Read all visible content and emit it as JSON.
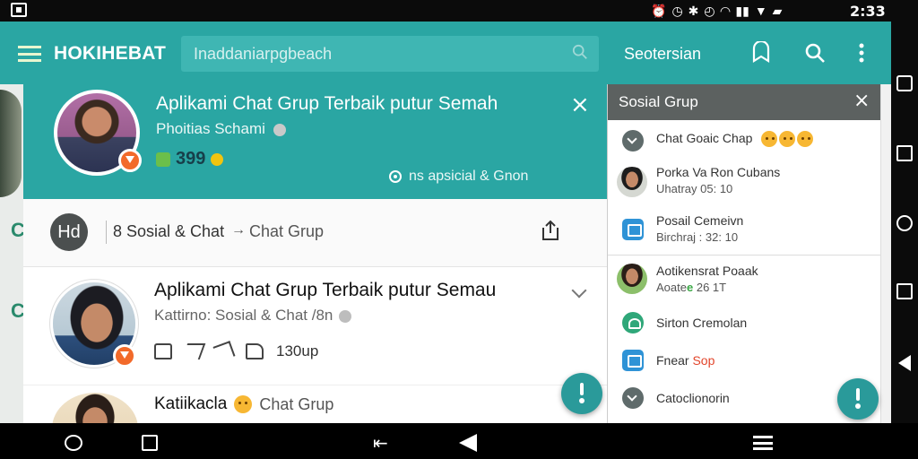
{
  "statusbar": {
    "time": "2:33",
    "icons": [
      "alarm-icon",
      "timer-icon",
      "bluetooth-icon",
      "clock-icon",
      "wifi-icon",
      "signal-icon",
      "wifi-icon",
      "battery-icon"
    ]
  },
  "appbar": {
    "brand": "HOKIHEBAT",
    "search_placeholder": "Inaddaniarpgbeach",
    "link_label": "Seotersian"
  },
  "hero": {
    "title": "Aplikami Chat Grup Terbaik putur Semah",
    "subtitle": "Phoitias Schami",
    "stat_value": "399",
    "location": "ns apsicial & Gnon",
    "close_label": "×"
  },
  "breadcrumb": {
    "avatar_text": "Hd",
    "crumb1": "8 Sosial & Chat",
    "arrow": "→",
    "crumb2": "Chat Grup"
  },
  "post1": {
    "title": "Aplikami Chat Grup Terbaik putur Semau",
    "subtitle": "Kattirno: Sosial & Chat /8n",
    "reaction_count": "130up"
  },
  "post2": {
    "name": "Katiikacla",
    "group": "Chat Grup"
  },
  "sidepanel": {
    "title": "Sosial Grup",
    "close_label": "×",
    "items": [
      {
        "title": "Chat Goaic Chap"
      },
      {
        "title": "Porka Va Ron Cubans",
        "sub": "Uhatray 05: 10"
      },
      {
        "title": "Posail Cemeivn",
        "sub": "Birchraj : 32: 10"
      },
      {
        "title": "Aotikensrat Poaak",
        "sub": "Aoate",
        "sub_accent": "e",
        "sub_tail": "26 1T"
      },
      {
        "title": "Sirton Cremolan"
      },
      {
        "title": "Fnear",
        "accent": "Sop"
      },
      {
        "title": "Catoclionorin"
      }
    ]
  },
  "colors": {
    "teal": "#2aa6a3",
    "panel_header": "#5c6160",
    "badge_orange": "#f26a2a"
  }
}
